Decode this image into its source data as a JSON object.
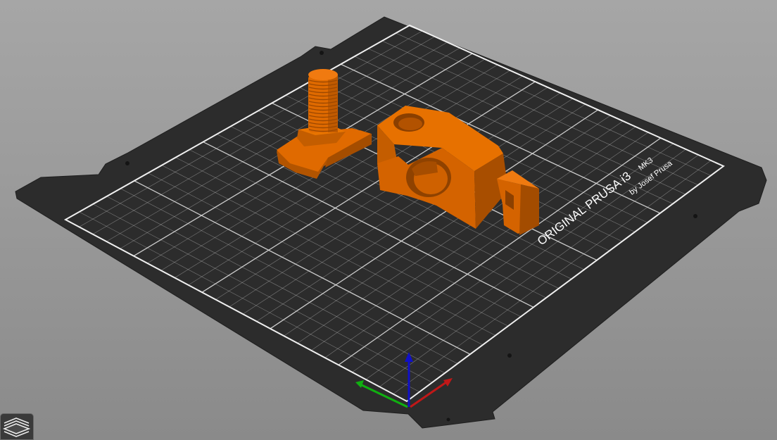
{
  "app": {
    "view": "3D"
  },
  "bed": {
    "brand_line1_a": "ORIGINAL PRUSA i3",
    "brand_line1_b": "MK3",
    "brand_line2": "by Josef Prusa",
    "surface_color": "#2b2b2b",
    "grid_color": "#d6d6d6"
  },
  "objects": [
    {
      "name": "bolt-part",
      "color": "#e06a00"
    },
    {
      "name": "clamp-part",
      "color": "#e06a00"
    }
  ],
  "axes": {
    "x_color": "#c01818",
    "y_color": "#10b010",
    "z_color": "#1010c8"
  },
  "toolbar": {
    "layers_icon": "layers-icon"
  }
}
